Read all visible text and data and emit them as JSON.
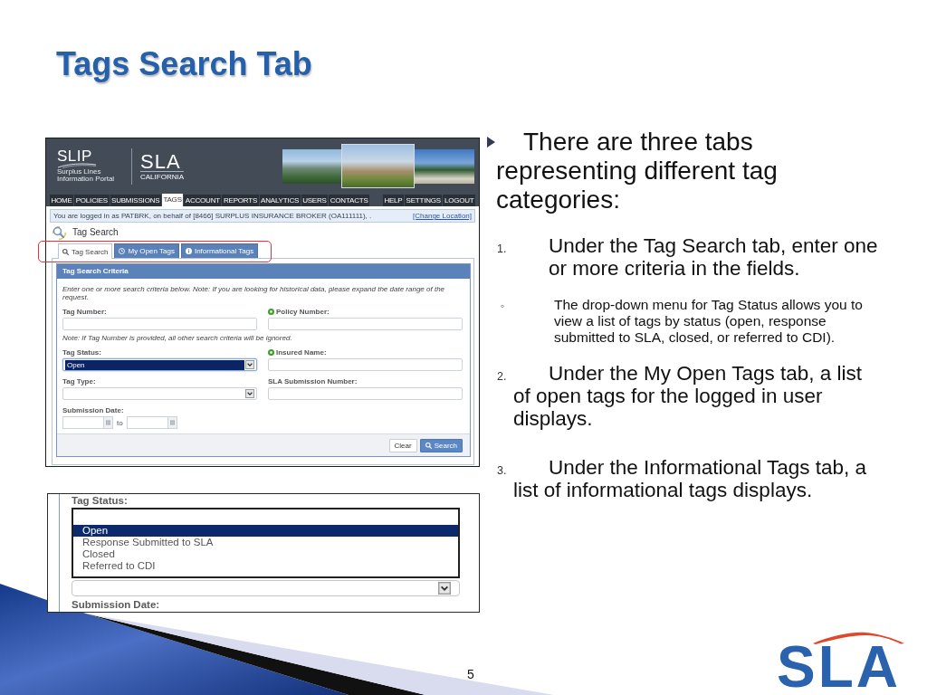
{
  "title": "Tags Search Tab",
  "screenshot": {
    "logos": {
      "slip": {
        "name": "SLIP",
        "tagline": "Surplus Lines Information Portal"
      },
      "sla": {
        "name": "SLA",
        "region": "CALIFORNIA"
      }
    },
    "banner_photos": [
      {
        "kind": "mountains"
      },
      {
        "kind": "city"
      },
      {
        "kind": "palms"
      }
    ],
    "nav_tabs": [
      {
        "label": "HOME",
        "selected": false
      },
      {
        "label": "POLICIES",
        "selected": false
      },
      {
        "label": "SUBMISSIONS",
        "selected": false
      },
      {
        "label": "TAGS",
        "selected": true
      },
      {
        "label": "ACCOUNT",
        "selected": false
      },
      {
        "label": "REPORTS",
        "selected": false
      },
      {
        "label": "ANALYTICS",
        "selected": false
      },
      {
        "label": "USERS",
        "selected": false
      },
      {
        "label": "CONTACTS",
        "selected": false
      }
    ],
    "utility_tabs": [
      "HELP",
      "SETTINGS",
      "LOGOUT"
    ],
    "login_notice": "You are logged in as PATBRK, on behalf of [8466] SURPLUS INSURANCE BROKER (OA111111), .",
    "change_location_link": "[Change Location]",
    "page_heading": "Tag Search",
    "tabs": [
      {
        "label": "Tag Search",
        "selected": true
      },
      {
        "label": "My Open Tags",
        "selected": false
      },
      {
        "label": "Informational Tags",
        "selected": false
      }
    ],
    "tabs_outlined": true,
    "criteria_panel": {
      "title": "Tag Search Criteria",
      "intro": "Enter one or more search criteria below. Note: If you are looking for historical data, please expand the date range of the request.",
      "rows": [
        {
          "cells": [
            {
              "kind": "text",
              "label": "Tag Number:",
              "badged": false
            },
            {
              "kind": "text",
              "label": "Policy Number:",
              "badged": true
            }
          ]
        },
        {
          "cells": [
            {
              "kind": "note",
              "text": "Note: If Tag Number is provided, all other search criteria will be ignored."
            }
          ]
        },
        {
          "cells": [
            {
              "kind": "select",
              "label": "Tag Status:",
              "value": "Open",
              "focused": true,
              "badged": false
            },
            {
              "kind": "text",
              "label": "Insured Name:",
              "badged": true
            }
          ]
        },
        {
          "cells": [
            {
              "kind": "select",
              "label": "Tag Type:",
              "focused": false,
              "badged": false
            },
            {
              "kind": "text",
              "label": "SLA Submission Number:",
              "badged": false
            }
          ]
        },
        {
          "cells": [
            {
              "kind": "date_range",
              "label": "Submission Date:",
              "separator": "to",
              "badged": false
            }
          ]
        }
      ],
      "buttons": [
        {
          "label": "Clear",
          "kind": "secondary"
        },
        {
          "label": "Search",
          "kind": "primary"
        }
      ]
    }
  },
  "zoom_inset": {
    "label": "Tag Status:",
    "blank_option": true,
    "options": [
      {
        "label": "Open",
        "selected": true
      },
      {
        "label": "Response Submitted to SLA",
        "selected": false
      },
      {
        "label": "Closed",
        "selected": false
      },
      {
        "label": "Referred to CDI",
        "selected": false
      }
    ],
    "next_label": "Submission Date:"
  },
  "bullet": "There are three tabs representing different tag categories:",
  "steps": [
    {
      "number": "1.",
      "kind": "hanging",
      "text": "Under the Tag Search tab, enter one or more criteria in the fields.",
      "sub_items": [
        {
          "marker": "◦",
          "text": "The drop-down menu for Tag Status allows you to view a list of tags by status (open, response submitted to SLA, closed, or referred to CDI)."
        }
      ]
    },
    {
      "number": "2.",
      "kind": "run_in",
      "text": "Under the My Open Tags tab, a list of open tags for the logged in user displays."
    },
    {
      "number": "3.",
      "kind": "run_in",
      "text": "Under the Informational Tags tab, a list of informational tags displays."
    }
  ],
  "page_number": "5",
  "logo": {
    "text": "SLA"
  }
}
